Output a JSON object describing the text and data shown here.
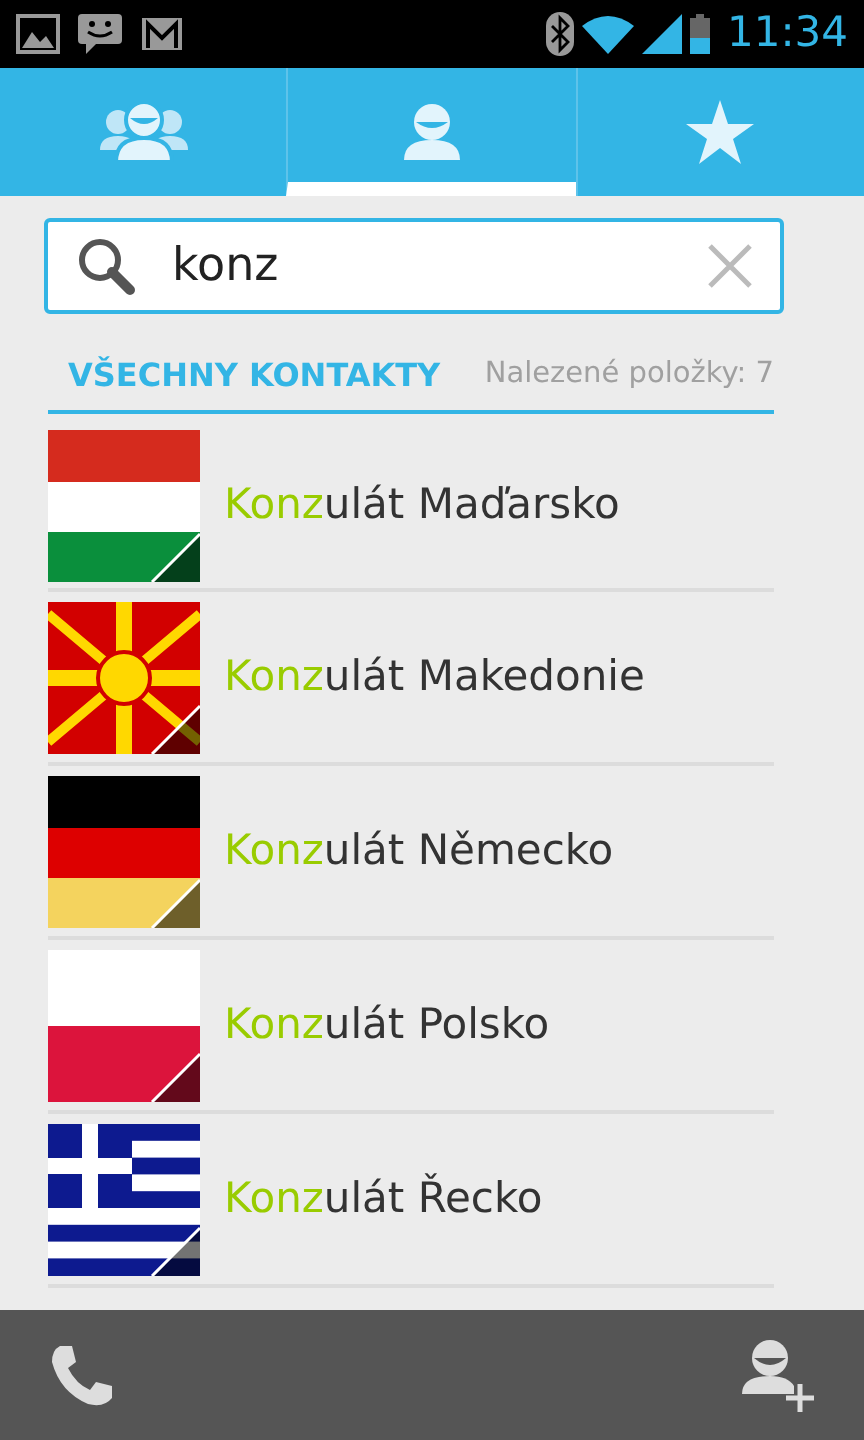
{
  "status_bar": {
    "time": "11:34"
  },
  "tabs": [
    {
      "kind": "groups",
      "selected": false
    },
    {
      "kind": "contacts",
      "selected": true
    },
    {
      "kind": "favorites",
      "selected": false
    }
  ],
  "search": {
    "value": "konz"
  },
  "header": {
    "title": "VŠECHNY KONTAKTY",
    "count": "Nalezené položky: 7"
  },
  "contacts": [
    {
      "match": "Konz",
      "rest": "ulát Maďarsko"
    },
    {
      "match": "Konz",
      "rest": "ulát Makedonie"
    },
    {
      "match": "Konz",
      "rest": "ulát Německo"
    },
    {
      "match": "Konz",
      "rest": "ulát Polsko"
    },
    {
      "match": "Konz",
      "rest": "ulát Řecko"
    }
  ]
}
